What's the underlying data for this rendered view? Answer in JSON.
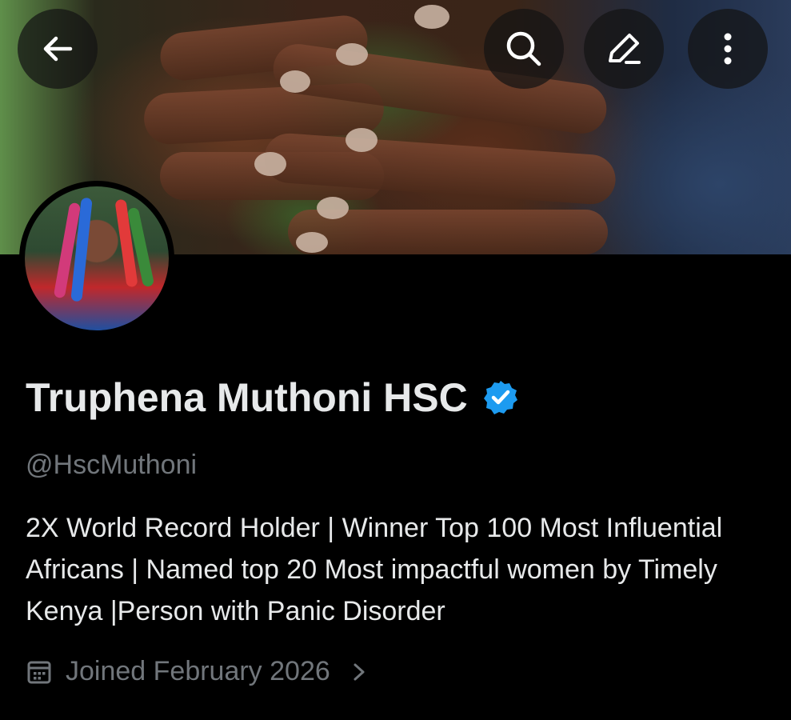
{
  "header": {
    "back_icon": "arrow-left-icon",
    "search_icon": "search-icon",
    "edit_icon": "pencil-icon",
    "more_icon": "more-vertical-icon"
  },
  "profile": {
    "display_name": "Truphena Muthoni HSC",
    "verified_icon": "verified-badge-icon",
    "verified_color": "#1d9bf0",
    "handle": "@HscMuthoni",
    "bio": "2X World Record Holder | Winner Top 100 Most Influential Africans | Named top  20 Most impactful women by Timely Kenya |Person with Panic Disorder",
    "joined": "Joined February 2026",
    "calendar_icon": "calendar-icon",
    "chevron_icon": "chevron-right-icon"
  },
  "colors": {
    "background": "#000000",
    "primary_text": "#e7e9ea",
    "secondary_text": "#71767b"
  }
}
